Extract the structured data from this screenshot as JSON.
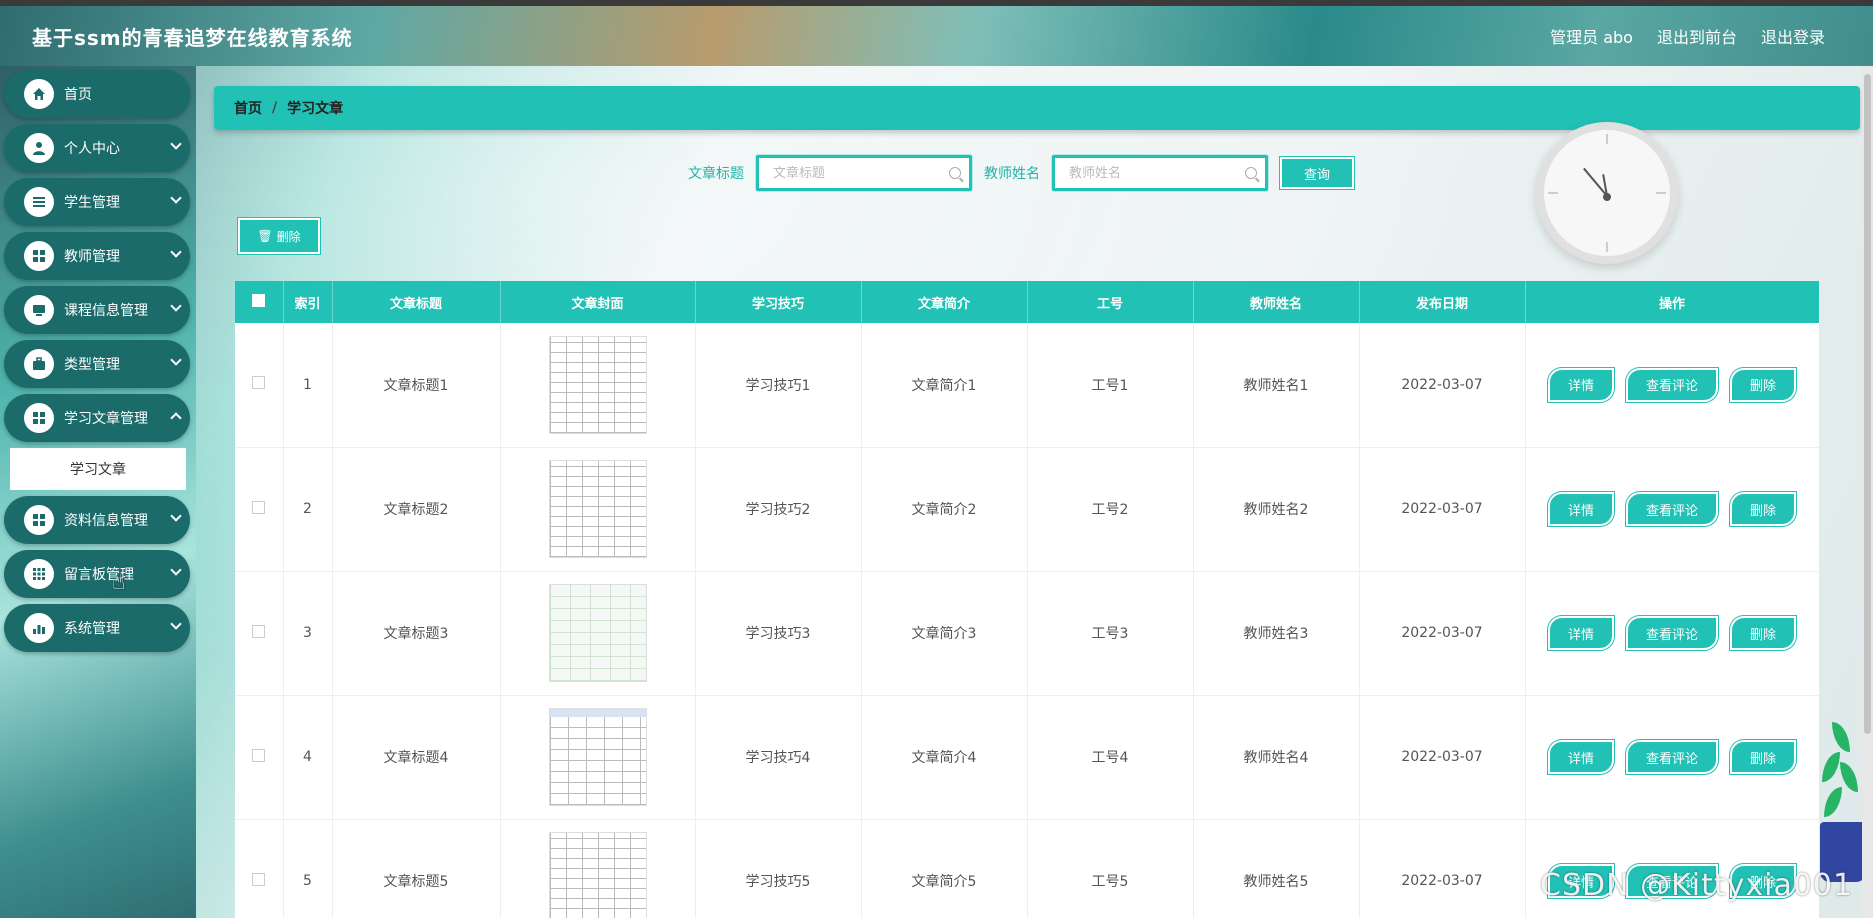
{
  "header": {
    "title": "基于ssm的青春追梦在线教育系统",
    "user": "管理员 abo",
    "to_front": "退出到前台",
    "logout": "退出登录"
  },
  "sidebar": {
    "items": [
      {
        "label": "首页",
        "icon": "home-icon"
      },
      {
        "label": "个人中心",
        "icon": "user-icon"
      },
      {
        "label": "学生管理",
        "icon": "list-icon"
      },
      {
        "label": "教师管理",
        "icon": "grid-icon"
      },
      {
        "label": "课程信息管理",
        "icon": "monitor-icon"
      },
      {
        "label": "类型管理",
        "icon": "briefcase-icon"
      },
      {
        "label": "学习文章管理",
        "icon": "grid-icon"
      },
      {
        "label": "资料信息管理",
        "icon": "grid-icon"
      },
      {
        "label": "留言板管理",
        "icon": "apps-icon"
      },
      {
        "label": "系统管理",
        "icon": "chart-icon"
      }
    ],
    "submenu": "学习文章"
  },
  "breadcrumb": {
    "home": "首页",
    "sep": "/",
    "current": "学习文章"
  },
  "search": {
    "title_label": "文章标题",
    "title_placeholder": "文章标题",
    "teacher_label": "教师姓名",
    "teacher_placeholder": "教师姓名",
    "query_button": "查询"
  },
  "toolbar": {
    "delete_label": "删除"
  },
  "table": {
    "headers": [
      "索引",
      "文章标题",
      "文章封面",
      "学习技巧",
      "文章简介",
      "工号",
      "教师姓名",
      "发布日期",
      "操作"
    ],
    "rows": [
      {
        "index": "1",
        "title": "文章标题1",
        "tip": "学习技巧1",
        "intro": "文章简介1",
        "job": "工号1",
        "teacher": "教师姓名1",
        "date": "2022-03-07"
      },
      {
        "index": "2",
        "title": "文章标题2",
        "tip": "学习技巧2",
        "intro": "文章简介2",
        "job": "工号2",
        "teacher": "教师姓名2",
        "date": "2022-03-07"
      },
      {
        "index": "3",
        "title": "文章标题3",
        "tip": "学习技巧3",
        "intro": "文章简介3",
        "job": "工号3",
        "teacher": "教师姓名3",
        "date": "2022-03-07"
      },
      {
        "index": "4",
        "title": "文章标题4",
        "tip": "学习技巧4",
        "intro": "文章简介4",
        "job": "工号4",
        "teacher": "教师姓名4",
        "date": "2022-03-07"
      },
      {
        "index": "5",
        "title": "文章标题5",
        "tip": "学习技巧5",
        "intro": "文章简介5",
        "job": "工号5",
        "teacher": "教师姓名5",
        "date": "2022-03-07"
      }
    ],
    "ops": {
      "detail": "详情",
      "comments": "查看评论",
      "delete": "删除"
    }
  },
  "watermark": "CSDN @Kittyxia001",
  "colors": {
    "accent": "#22c1b5",
    "menu_bg": "#1b6b6a"
  }
}
